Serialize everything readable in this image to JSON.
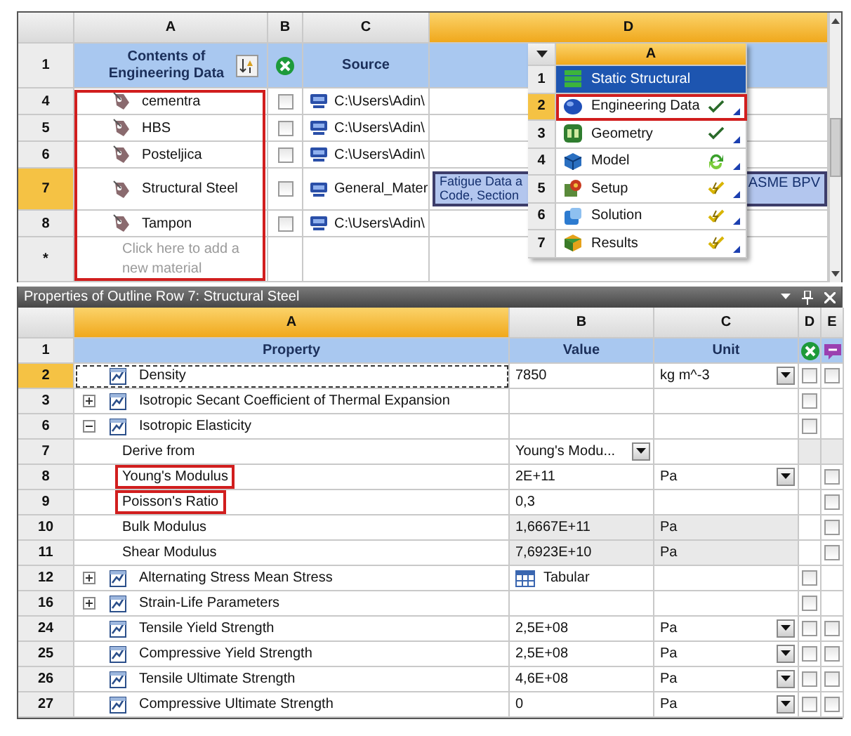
{
  "outline": {
    "columns": [
      {
        "label": "A",
        "selected": false
      },
      {
        "label": "B",
        "selected": false
      },
      {
        "label": "C",
        "selected": false
      },
      {
        "label": "D",
        "selected": true
      }
    ],
    "header": {
      "number": "1",
      "contents": "Contents of Engineering Data",
      "source": "Source"
    },
    "materials": [
      {
        "number": "4",
        "name": "cementra",
        "checked": false,
        "source": "C:\\Users\\Adin\\",
        "selected": false
      },
      {
        "number": "5",
        "name": "HBS",
        "checked": false,
        "source": "C:\\Users\\Adin\\",
        "selected": false
      },
      {
        "number": "6",
        "name": "Posteljica",
        "checked": false,
        "source": "C:\\Users\\Adin\\",
        "selected": false
      },
      {
        "number": "7",
        "name": "Structural Steel",
        "checked": false,
        "source": "General_Mater",
        "selected": true,
        "description_start": "Fatigue Data a Code, Section",
        "description_end": "ASME BPV"
      },
      {
        "number": "8",
        "name": "Tampon",
        "checked": false,
        "source": "C:\\Users\\Adin\\",
        "selected": false
      }
    ],
    "new_row": {
      "number": "*",
      "placeholder": "Click here to add a new material"
    },
    "highlighted": true
  },
  "schematic": {
    "column": "A",
    "items": [
      {
        "number": "1",
        "label": "Static Structural",
        "kind": "system",
        "selected": false,
        "highlighted": false
      },
      {
        "number": "2",
        "label": "Engineering Data",
        "kind": "cell",
        "selected": true,
        "highlighted": true,
        "status": {
          "kind": "check"
        }
      },
      {
        "number": "3",
        "label": "Geometry",
        "kind": "cell",
        "selected": false,
        "highlighted": false,
        "status": {
          "kind": "check"
        }
      },
      {
        "number": "4",
        "label": "Model",
        "kind": "cell",
        "selected": false,
        "highlighted": false,
        "status": {
          "kind": "refresh"
        }
      },
      {
        "number": "5",
        "label": "Setup",
        "kind": "cell",
        "selected": false,
        "highlighted": false,
        "status": {
          "kind": "update"
        }
      },
      {
        "number": "6",
        "label": "Solution",
        "kind": "cell",
        "selected": false,
        "highlighted": false,
        "status": {
          "kind": "update"
        }
      },
      {
        "number": "7",
        "label": "Results",
        "kind": "cell",
        "selected": false,
        "highlighted": false,
        "status": {
          "kind": "update"
        }
      }
    ]
  },
  "properties": {
    "title": "Properties of Outline Row 7: Structural Steel",
    "columns": [
      {
        "label": "A",
        "selected": true
      },
      {
        "label": "B",
        "selected": false
      },
      {
        "label": "C",
        "selected": false
      },
      {
        "label": "D",
        "selected": false
      },
      {
        "label": "E",
        "selected": false
      }
    ],
    "header": {
      "number": "1",
      "property": "Property",
      "value": "Value",
      "unit": "Unit"
    },
    "rows": [
      {
        "number": "2",
        "name": "Density",
        "kind": "text",
        "value": "7850",
        "unit": "kg m^-3",
        "unit_dropdown": true,
        "d_checked": false,
        "e_checked": false,
        "selected": true
      },
      {
        "number": "3",
        "name": "Isotropic Secant Coefficient of Thermal Expansion",
        "kind": "group",
        "expanded": false,
        "d_checked": false,
        "selected": false
      },
      {
        "number": "6",
        "name": "Isotropic Elasticity",
        "kind": "group",
        "expanded": true,
        "d_checked": false,
        "selected": false,
        "children": [
          {
            "number": "7",
            "name": "Derive from",
            "kind": "dropdown",
            "value": "Young's Modu...",
            "selected": false
          },
          {
            "number": "8",
            "name": "Young's Modulus",
            "kind": "text",
            "value": "2E+11",
            "unit": "Pa",
            "unit_dropdown": true,
            "e_checked": false,
            "selected": false,
            "highlighted": true
          },
          {
            "number": "9",
            "name": "Poisson's Ratio",
            "kind": "text",
            "value": "0,3",
            "e_checked": false,
            "selected": false,
            "highlighted": true
          },
          {
            "number": "10",
            "name": "Bulk Modulus",
            "kind": "text",
            "value": "1,6667E+11",
            "unit": "Pa",
            "unit_dropdown": false,
            "readonly": true,
            "e_checked": false,
            "selected": false
          },
          {
            "number": "11",
            "name": "Shear Modulus",
            "kind": "text",
            "value": "7,6923E+10",
            "unit": "Pa",
            "unit_dropdown": false,
            "readonly": true,
            "e_checked": false,
            "selected": false
          }
        ]
      },
      {
        "number": "12",
        "name": "Alternating Stress Mean Stress",
        "kind": "tabular",
        "expanded": false,
        "value": "Tabular",
        "d_checked": false,
        "selected": false
      },
      {
        "number": "16",
        "name": "Strain-Life Parameters",
        "kind": "group",
        "expanded": false,
        "d_checked": false,
        "selected": false
      },
      {
        "number": "24",
        "name": "Tensile Yield Strength",
        "kind": "text",
        "value": "2,5E+08",
        "unit": "Pa",
        "unit_dropdown": true,
        "d_checked": false,
        "e_checked": false,
        "selected": false
      },
      {
        "number": "25",
        "name": "Compressive Yield Strength",
        "kind": "text",
        "value": "2,5E+08",
        "unit": "Pa",
        "unit_dropdown": true,
        "d_checked": false,
        "e_checked": false,
        "selected": false
      },
      {
        "number": "26",
        "name": "Tensile Ultimate Strength",
        "kind": "text",
        "value": "4,6E+08",
        "unit": "Pa",
        "unit_dropdown": true,
        "d_checked": false,
        "e_checked": false,
        "selected": false
      },
      {
        "number": "27",
        "name": "Compressive Ultimate Strength",
        "kind": "text",
        "value": "0",
        "unit": "Pa",
        "unit_dropdown": true,
        "d_checked": false,
        "e_checked": false,
        "selected": false
      }
    ]
  }
}
